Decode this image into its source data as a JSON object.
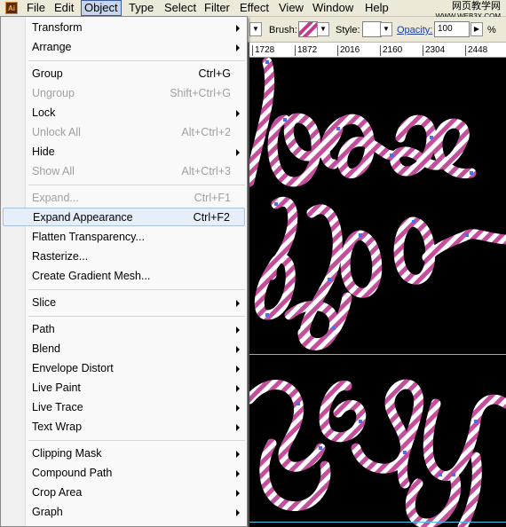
{
  "menubar": {
    "app_icon": "Ai",
    "items": [
      "File",
      "Edit",
      "Object",
      "Type",
      "Select",
      "Filter",
      "Effect",
      "View",
      "Window",
      "Help"
    ],
    "active": "Object",
    "watermark_line1": "网页教学网",
    "watermark_line2": "WWW.WEB3X.COM"
  },
  "controlbar": {
    "brush_label": "Brush:",
    "style_label": "Style:",
    "opacity_label": "Opacity:",
    "opacity_value": "100",
    "opacity_unit": "%"
  },
  "ruler": {
    "ticks": [
      "1728",
      "1872",
      "2016",
      "2160",
      "2304",
      "2448"
    ]
  },
  "object_menu": {
    "items": [
      {
        "label": "Transform",
        "shortcut": "",
        "submenu": true,
        "disabled": false
      },
      {
        "label": "Arrange",
        "shortcut": "",
        "submenu": true,
        "disabled": false
      },
      {
        "label": "Group",
        "shortcut": "Ctrl+G",
        "submenu": false,
        "disabled": false
      },
      {
        "label": "Ungroup",
        "shortcut": "Shift+Ctrl+G",
        "submenu": false,
        "disabled": true
      },
      {
        "label": "Lock",
        "shortcut": "",
        "submenu": true,
        "disabled": false
      },
      {
        "label": "Unlock All",
        "shortcut": "Alt+Ctrl+2",
        "submenu": false,
        "disabled": true
      },
      {
        "label": "Hide",
        "shortcut": "",
        "submenu": true,
        "disabled": false
      },
      {
        "label": "Show All",
        "shortcut": "Alt+Ctrl+3",
        "submenu": false,
        "disabled": true
      },
      {
        "label": "Expand...",
        "shortcut": "Ctrl+F1",
        "submenu": false,
        "disabled": true
      },
      {
        "label": "Expand Appearance",
        "shortcut": "Ctrl+F2",
        "submenu": false,
        "disabled": false,
        "highlighted": true
      },
      {
        "label": "Flatten Transparency...",
        "shortcut": "",
        "submenu": false,
        "disabled": false
      },
      {
        "label": "Rasterize...",
        "shortcut": "",
        "submenu": false,
        "disabled": false
      },
      {
        "label": "Create Gradient Mesh...",
        "shortcut": "",
        "submenu": false,
        "disabled": false
      },
      {
        "label": "Slice",
        "shortcut": "",
        "submenu": true,
        "disabled": false
      },
      {
        "label": "Path",
        "shortcut": "",
        "submenu": true,
        "disabled": false
      },
      {
        "label": "Blend",
        "shortcut": "",
        "submenu": true,
        "disabled": false
      },
      {
        "label": "Envelope Distort",
        "shortcut": "",
        "submenu": true,
        "disabled": false
      },
      {
        "label": "Live Paint",
        "shortcut": "",
        "submenu": true,
        "disabled": false
      },
      {
        "label": "Live Trace",
        "shortcut": "",
        "submenu": true,
        "disabled": false
      },
      {
        "label": "Text Wrap",
        "shortcut": "",
        "submenu": true,
        "disabled": false
      },
      {
        "label": "Clipping Mask",
        "shortcut": "",
        "submenu": true,
        "disabled": false
      },
      {
        "label": "Compound Path",
        "shortcut": "",
        "submenu": true,
        "disabled": false
      },
      {
        "label": "Crop Area",
        "shortcut": "",
        "submenu": true,
        "disabled": false
      },
      {
        "label": "Graph",
        "shortcut": "",
        "submenu": true,
        "disabled": false
      }
    ]
  },
  "colors": {
    "stroke_pink": "#c44d9c",
    "stroke_white": "#ffffff",
    "anchor_blue": "#4a6fe8",
    "guide_cyan": "#53c3e8"
  }
}
